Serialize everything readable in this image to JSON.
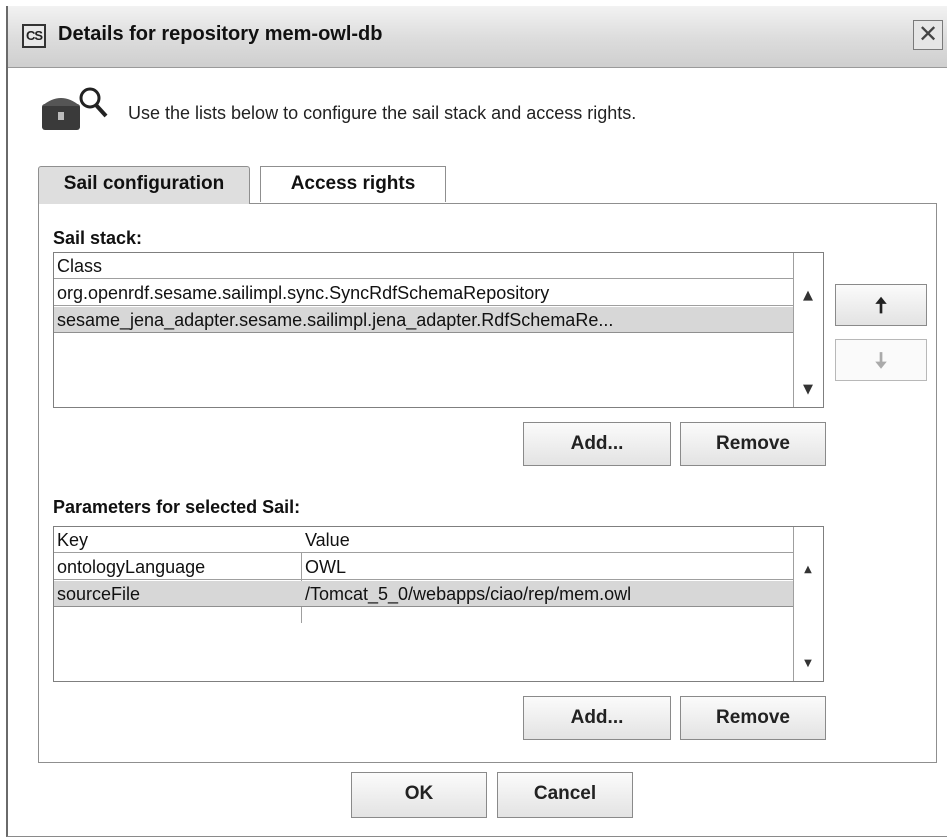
{
  "window": {
    "title": "Details for repository mem-owl-db",
    "app_icon_text": "CS",
    "close_glyph": "✕"
  },
  "header": {
    "icon": "chest-magnifier-icon",
    "instruction": "Use the lists below to configure the sail stack and access rights."
  },
  "tabs": [
    {
      "label": "Sail configuration",
      "active": true
    },
    {
      "label": "Access rights",
      "active": false
    }
  ],
  "sail_stack": {
    "label": "Sail stack:",
    "column": "Class",
    "rows": [
      "org.openrdf.sesame.sailimpl.sync.SyncRdfSchemaRepository",
      "sesame_jena_adapter.sesame.sailimpl.jena_adapter.RdfSchemaRe..."
    ],
    "selected_index": 1,
    "move_up_glyph": "🠅",
    "move_down_glyph": "🠇",
    "add_label": "Add...",
    "remove_label": "Remove"
  },
  "parameters": {
    "label": "Parameters for selected Sail:",
    "columns": [
      "Key",
      "Value"
    ],
    "rows": [
      {
        "key": "ontologyLanguage",
        "value": "OWL"
      },
      {
        "key": "sourceFile",
        "value": "/Tomcat_5_0/webapps/ciao/rep/mem.owl"
      }
    ],
    "selected_index": 1,
    "add_label": "Add...",
    "remove_label": "Remove"
  },
  "footer": {
    "ok_label": "OK",
    "cancel_label": "Cancel"
  },
  "scroll_glyphs": {
    "up": "▲",
    "down": "▼"
  }
}
